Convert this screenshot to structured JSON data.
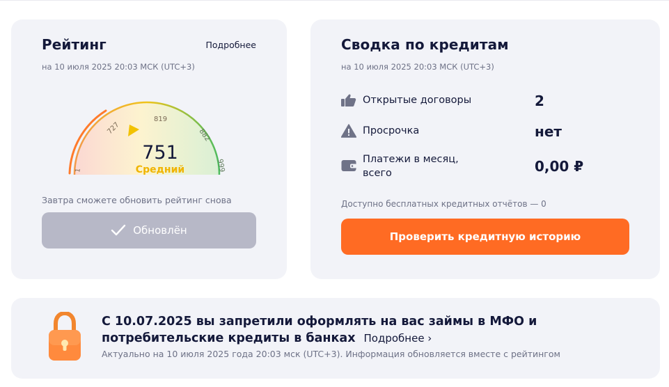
{
  "rating": {
    "title": "Рейтинг",
    "more_link": "Подробнее",
    "date": "на 10 июля 2025 20:03 МСК (UTC+3)",
    "score": "751",
    "level": "Средний",
    "gauge_ticks": [
      "1",
      "727",
      "819",
      "882",
      "999"
    ],
    "refresh_note": "Завтра сможете обновить рейтинг снова",
    "refresh_button": "Обновлён",
    "colors": {
      "low": "#ff7b2c",
      "mid": "#f0c419",
      "high": "#4dbb5f",
      "pointer": "#f2c200"
    }
  },
  "summary": {
    "title": "Сводка по кредитам",
    "date": "на 10 июля 2025 20:03 МСК (UTC+3)",
    "rows": [
      {
        "icon": "thumbs-up-icon",
        "label": "Открытые договоры",
        "value": "2"
      },
      {
        "icon": "warning-icon",
        "label": "Просрочка",
        "value": "нет"
      },
      {
        "icon": "wallet-icon",
        "label": "Платежи в месяц,",
        "label2": "всего",
        "value": "0,00 ₽"
      }
    ],
    "free_reports": "Доступно бесплатных кредитных отчётов — 0",
    "check_button": "Проверить кредитную историю",
    "accent": "#ff6b23"
  },
  "ban": {
    "icon": "lock-icon",
    "text": "С 10.07.2025 вы запретили оформлять на вас  займы в МФО и потребительские кредиты в банках",
    "more_link": "Подробнее ›",
    "updated": "Актуально на 10 июля 2025 года 20:03 мск (UTC+3). Информация обновляется вместе с рейтингом"
  }
}
